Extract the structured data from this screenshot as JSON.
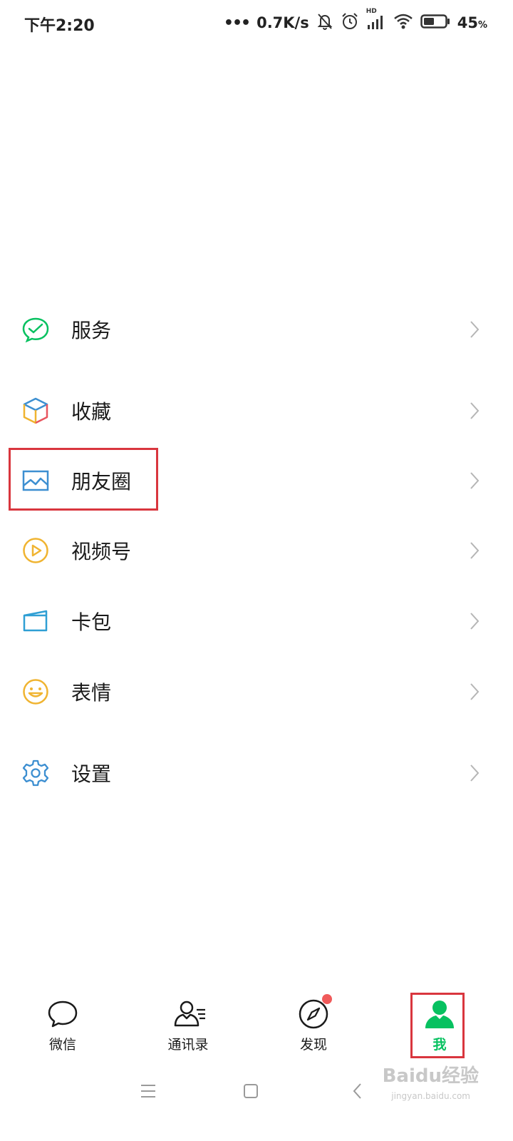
{
  "status_bar": {
    "time": "下午2:20",
    "dots": "•••",
    "network_speed": "0.7K/s",
    "battery_percent": "45",
    "battery_unit": "%",
    "hd_label": "HD",
    "icons": [
      "mute-bell-icon",
      "alarm-icon",
      "signal-icon",
      "wifi-icon",
      "battery-icon"
    ]
  },
  "menu": {
    "items": [
      {
        "label": "服务",
        "icon": "service-icon",
        "color": "#07c160"
      },
      {
        "label": "收藏",
        "icon": "favorites-cube-icon",
        "color": "#f0b431"
      },
      {
        "label": "朋友圈",
        "icon": "moments-picture-icon",
        "color": "#3d8fd1"
      },
      {
        "label": "视频号",
        "icon": "channels-play-icon",
        "color": "#f0b431"
      },
      {
        "label": "卡包",
        "icon": "card-wallet-icon",
        "color": "#2f9fd4"
      },
      {
        "label": "表情",
        "icon": "emoji-smile-icon",
        "color": "#f0b431"
      },
      {
        "label": "设置",
        "icon": "settings-gear-icon",
        "color": "#3d8fd1"
      }
    ]
  },
  "tabbar": {
    "tabs": [
      {
        "label": "微信",
        "icon": "chat-bubble-icon"
      },
      {
        "label": "通讯录",
        "icon": "contacts-icon"
      },
      {
        "label": "发现",
        "icon": "compass-icon",
        "badge": true
      },
      {
        "label": "我",
        "icon": "me-person-icon",
        "active": true
      }
    ],
    "active_color": "#07c160"
  },
  "watermark": {
    "text": "Baidu经验",
    "sub": "jingyan.baidu.com"
  },
  "highlight_color": "#d9363e"
}
